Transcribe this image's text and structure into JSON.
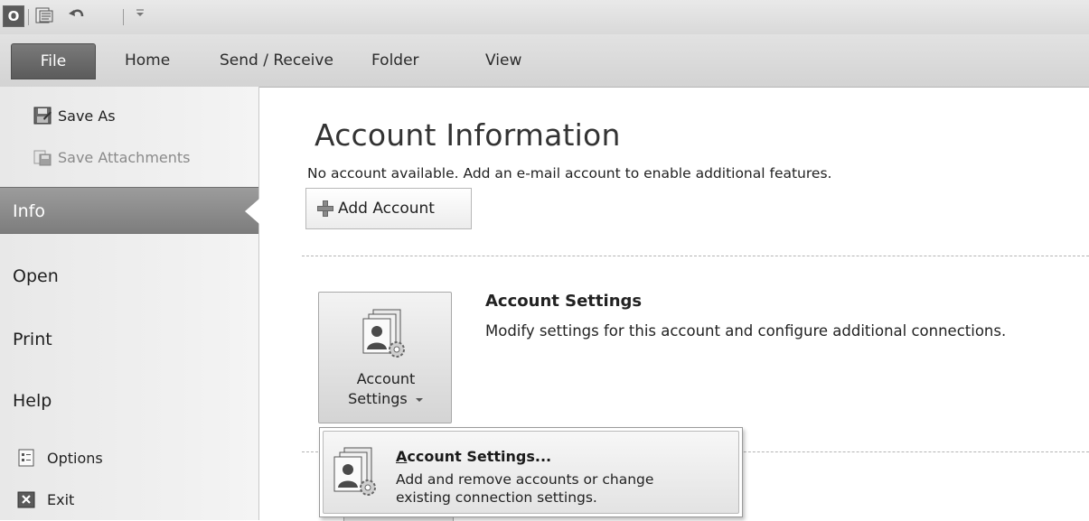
{
  "quick_access": {
    "app_glyph": "O",
    "icons": [
      "outlook-icon",
      "send-receive-all-icon",
      "undo-icon",
      "customize-toolbar-icon"
    ]
  },
  "ribbon": {
    "tabs": [
      {
        "label": "File"
      },
      {
        "label": "Home"
      },
      {
        "label": "Send / Receive"
      },
      {
        "label": "Folder"
      },
      {
        "label": "View"
      }
    ]
  },
  "nav": {
    "commands": [
      {
        "label": "Save As",
        "icon": "save-as-icon"
      },
      {
        "label": "Save Attachments",
        "icon": "save-attachments-icon",
        "disabled": true
      }
    ],
    "items": [
      {
        "label": "Info",
        "selected": true
      },
      {
        "label": "Open"
      },
      {
        "label": "Print"
      },
      {
        "label": "Help"
      }
    ],
    "footer": [
      {
        "label": "Options",
        "icon": "options-icon"
      },
      {
        "label": "Exit",
        "icon": "exit-icon"
      }
    ]
  },
  "main": {
    "title": "Account Information",
    "subtitle": "No account available. Add an e-mail account to enable additional features.",
    "add_account_label": "Add Account",
    "account_settings": {
      "button_line1": "Account",
      "button_line2": "Settings",
      "section_title": "Account Settings",
      "section_desc": "Modify settings for this account and configure additional connections."
    }
  },
  "dropdown": {
    "item_title_accel": "A",
    "item_title_rest": "ccount Settings...",
    "item_desc_line1": "Add and remove accounts or change",
    "item_desc_line2": "existing connection settings."
  },
  "colors": {
    "file_tab": "#5b5b5b",
    "info_selected": "#8a8a8a",
    "nav_bg": "#eeeeee",
    "page_bg": "#ffffff"
  }
}
